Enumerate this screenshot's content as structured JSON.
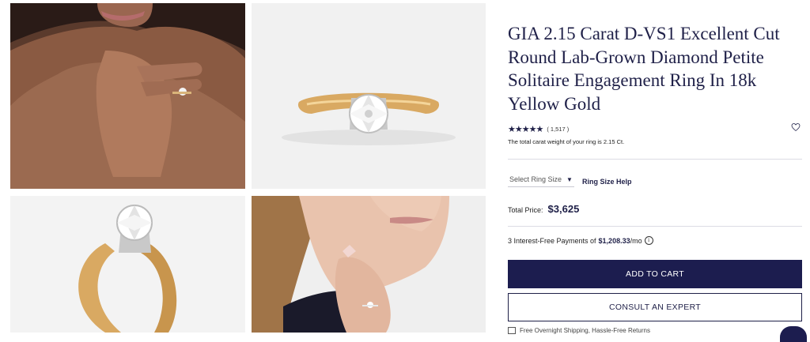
{
  "product": {
    "title": "GIA 2.15 Carat D-VS1 Excellent Cut Round Lab-Grown Diamond Petite Solitaire Engagement Ring In 18k Yellow Gold",
    "rating_stars": "★★★★★",
    "rating_count": "( 1,517 )",
    "carat_note": "The total carat weight of your ring is 2.15 Ct.",
    "ring_size_placeholder": "Select Ring Size",
    "ring_size_help": "Ring Size Help",
    "price_label": "Total Price:",
    "price": "$3,625",
    "installments_prefix": "3 Interest-Free Payments of",
    "installments_amount": "$1,208.33",
    "installments_suffix": "/mo",
    "info_glyph": "i",
    "add_to_cart": "ADD TO CART",
    "consult_expert": "CONSULT AN EXPERT",
    "shipping_note": "Free Overnight Shipping, Hassle-Free Returns"
  },
  "icons": {
    "rating": "star-icon",
    "wishlist": "heart-icon",
    "dropdown": "chevron-down-icon",
    "info": "info-icon",
    "shipping": "box-icon",
    "chat": "chat-icon"
  },
  "gallery": [
    "model-hand-on-chin-photo",
    "ring-front-view-photo",
    "ring-angled-view-photo",
    "model-profile-ring-photo"
  ],
  "colors": {
    "brand_navy": "#1c1d4f",
    "gold": "#d9a962",
    "divider": "#dcdce4"
  }
}
